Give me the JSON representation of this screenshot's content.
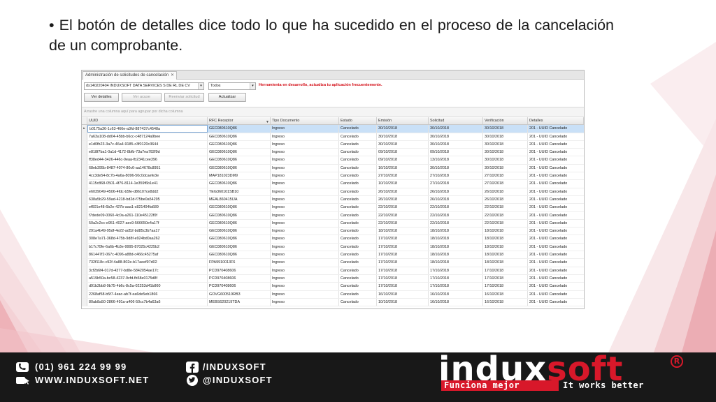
{
  "slide": {
    "bullet": "• El botón de detalles dice todo lo que ha sucedido en el proceso de la cancelación de un comprobante."
  },
  "app": {
    "tab_title": "Administración de solicitudes de cancelación",
    "tab_close": "✕",
    "company_combo": "ds140220404 INDUXSOFT DATA SERVICES S DE RL DE CV",
    "filter_combo": "Todos",
    "warning": "Herramienta en desarrollo, actualiza tu aplicación frecuentemente.",
    "buttons": {
      "details": "Ver detalles",
      "view_ack": "Ver acuse",
      "resend": "Reenviar solicitud",
      "update": "Actualizar"
    },
    "group_panel_hint": "Arrastre una columna aquí para agrupar por dicha columna",
    "columns": [
      "UUID",
      "RFC Receptor",
      "Tipo Documento",
      "Estado",
      "Emisión",
      "Solicitud",
      "Verificación",
      "Detalles"
    ],
    "rows": [
      [
        "b0175a36-1c63-466e-a3fd-887437c4548a",
        "GEC080610Q86",
        "Ingreso",
        "Cancelado",
        "30/10/2018",
        "30/10/2018",
        "30/10/2018",
        "201 - UUID Cancelado"
      ],
      [
        "7a63a108-dd04-45bb-b6cc-c487124a9bee",
        "GEC080610Q86",
        "Ingreso",
        "Cancelado",
        "30/10/2018",
        "30/10/2018",
        "30/10/2018",
        "201 - UUID Cancelado"
      ],
      [
        "e1d0fb23-3a7c-46a4-9185-c3f0120c3644",
        "GEC080610Q86",
        "Ingreso",
        "Cancelado",
        "30/10/2018",
        "30/10/2018",
        "30/10/2018",
        "201 - UUID Cancelado"
      ],
      [
        "e818f7ba1-0a1d-4172-8bfb-73a7ea782f9d",
        "GEC080610Q86",
        "Ingreso",
        "Cancelado",
        "09/10/2018",
        "09/10/2018",
        "30/10/2018",
        "201 - UUID Cancelado"
      ],
      [
        "ff38ed44-3426-446c-9eaa-fb2341cee396",
        "GEC080610Q86",
        "Ingreso",
        "Cancelado",
        "09/10/2018",
        "13/10/2018",
        "30/10/2018",
        "201 - UUID Cancelado"
      ],
      [
        "68eb395b-8487-4074-80c6-aa14678c8951",
        "GEC080610Q86",
        "Ingreso",
        "Cancelado",
        "16/10/2018",
        "30/10/2018",
        "30/10/2018",
        "201 - UUID Cancelado"
      ],
      [
        "4cc3de54-8c7b-4a6a-8096-50c0dcaefe3e",
        "MAP181023DM9",
        "Ingreso",
        "Cancelado",
        "27/10/2018",
        "27/10/2018",
        "27/10/2018",
        "201 - UUID Cancelado"
      ],
      [
        "4115c868-0501-4f76-8114-1e359f6b1e41",
        "GEC080610Q86",
        "Ingreso",
        "Cancelado",
        "10/10/2018",
        "27/10/2018",
        "27/10/2018",
        "201 - UUID Cancelado"
      ],
      [
        "e6039049-4506-4fdc-b5fe-d86107ce8dd2",
        "TEG360101SB10",
        "Ingreso",
        "Cancelado",
        "26/10/2018",
        "26/10/2018",
        "26/10/2018",
        "201 - UUID Cancelado"
      ],
      [
        "638a5b29-59ad-4218-bd2d-f75be0a54295",
        "MEAL860415IJA",
        "Ingreso",
        "Cancelado",
        "26/10/2018",
        "26/10/2018",
        "26/10/2018",
        "201 - UUID Cancelado"
      ],
      [
        "ef601e48-6b2e-427b-aaa1-c821404fa689",
        "GEC080610Q86",
        "Ingreso",
        "Cancelado",
        "22/10/2018",
        "22/10/2018",
        "22/10/2018",
        "201 - UUID Cancelado"
      ],
      [
        "f7dede09-0060-4c0a-a261-110e45122f0f",
        "GEC080610Q86",
        "Ingreso",
        "Cancelado",
        "22/10/2018",
        "22/10/2018",
        "22/10/2018",
        "201 - UUID Cancelado"
      ],
      [
        "50a2c2cc-e951-4027-aec9-566650e4a17f",
        "GEC080610Q86",
        "Ingreso",
        "Cancelado",
        "22/10/2018",
        "22/10/2018",
        "22/10/2018",
        "201 - UUID Cancelado"
      ],
      [
        "291a4b49-95df-4e22-ad52-bd85c3b7aa17",
        "GEC080610Q86",
        "Ingreso",
        "Cancelado",
        "18/10/2018",
        "18/10/2018",
        "18/10/2018",
        "201 - UUID Cancelado"
      ],
      [
        "308e7a71-368d-475b-9d8f-e924bd0aa262",
        "GEC080610Q86",
        "Ingreso",
        "Cancelado",
        "17/10/2018",
        "18/10/2018",
        "18/10/2018",
        "201 - UUID Cancelado"
      ],
      [
        "b17c70fe-6a6b-4b3e-9995-87025c4225b2",
        "GEC080610Q86",
        "Ingreso",
        "Cancelado",
        "17/10/2018",
        "18/10/2018",
        "18/10/2018",
        "201 - UUID Cancelado"
      ],
      [
        "861447f2-067c-4096-a88d-c466c45275af",
        "GEC080610Q86",
        "Ingreso",
        "Cancelado",
        "17/10/2018",
        "18/10/2018",
        "18/10/2018",
        "201 - UUID Cancelado"
      ],
      [
        "732f118c-c92f-4a88-802e-b17aeef97d02",
        "FPA9910013F6",
        "Ingreso",
        "Cancelado",
        "17/10/2018",
        "18/10/2018",
        "18/10/2018",
        "201 - UUID Cancelado"
      ],
      [
        "3cf2b6f4-017d-4377-bd8e-5842054ae17c",
        "PCD970408606",
        "Ingreso",
        "Cancelado",
        "17/10/2018",
        "17/10/2018",
        "17/10/2018",
        "201 - UUID Cancelado"
      ],
      [
        "a519b50a-bc58-4237-9cfd-fb58e0175d8f",
        "PCD970408606",
        "Ingreso",
        "Cancelado",
        "17/10/2018",
        "17/10/2018",
        "17/10/2018",
        "201 - UUID Cancelado"
      ],
      [
        "d91b2bb8-9b75-4b6c-8c5a-02253d41b860",
        "PCD970408606",
        "Ingreso",
        "Cancelado",
        "17/10/2018",
        "17/10/2018",
        "17/10/2018",
        "201 - UUID Cancelado"
      ],
      [
        "2268af58-b5f7-4eac-ab7f-ea6de5eb1866",
        "GOVG600519RB3",
        "Ingreso",
        "Cancelado",
        "16/10/2018",
        "16/10/2018",
        "16/10/2018",
        "201 - UUID Cancelado"
      ],
      [
        "80ab8a50-2866-491a-a406-50cc7b4a63a6",
        "MEBS620219TDA",
        "Ingreso",
        "Cancelado",
        "10/10/2018",
        "16/10/2018",
        "16/10/2018",
        "201 - UUID Cancelado"
      ]
    ]
  },
  "footer": {
    "phone": "(01) 961 224 99 99",
    "web": "WWW.INDUXSOFT.NET",
    "facebook": "/INDUXSOFT",
    "twitter": "@INDUXSOFT",
    "logo_main": "indux",
    "logo_accent": "soft",
    "logo_reg": "R",
    "tagline_es": "Funciona mejor",
    "tagline_en": "It works better"
  },
  "colors": {
    "brand_red": "#d8182a",
    "warning_red": "#d4111a",
    "selection": "#c9e0f7",
    "footer_bg": "#181818"
  }
}
